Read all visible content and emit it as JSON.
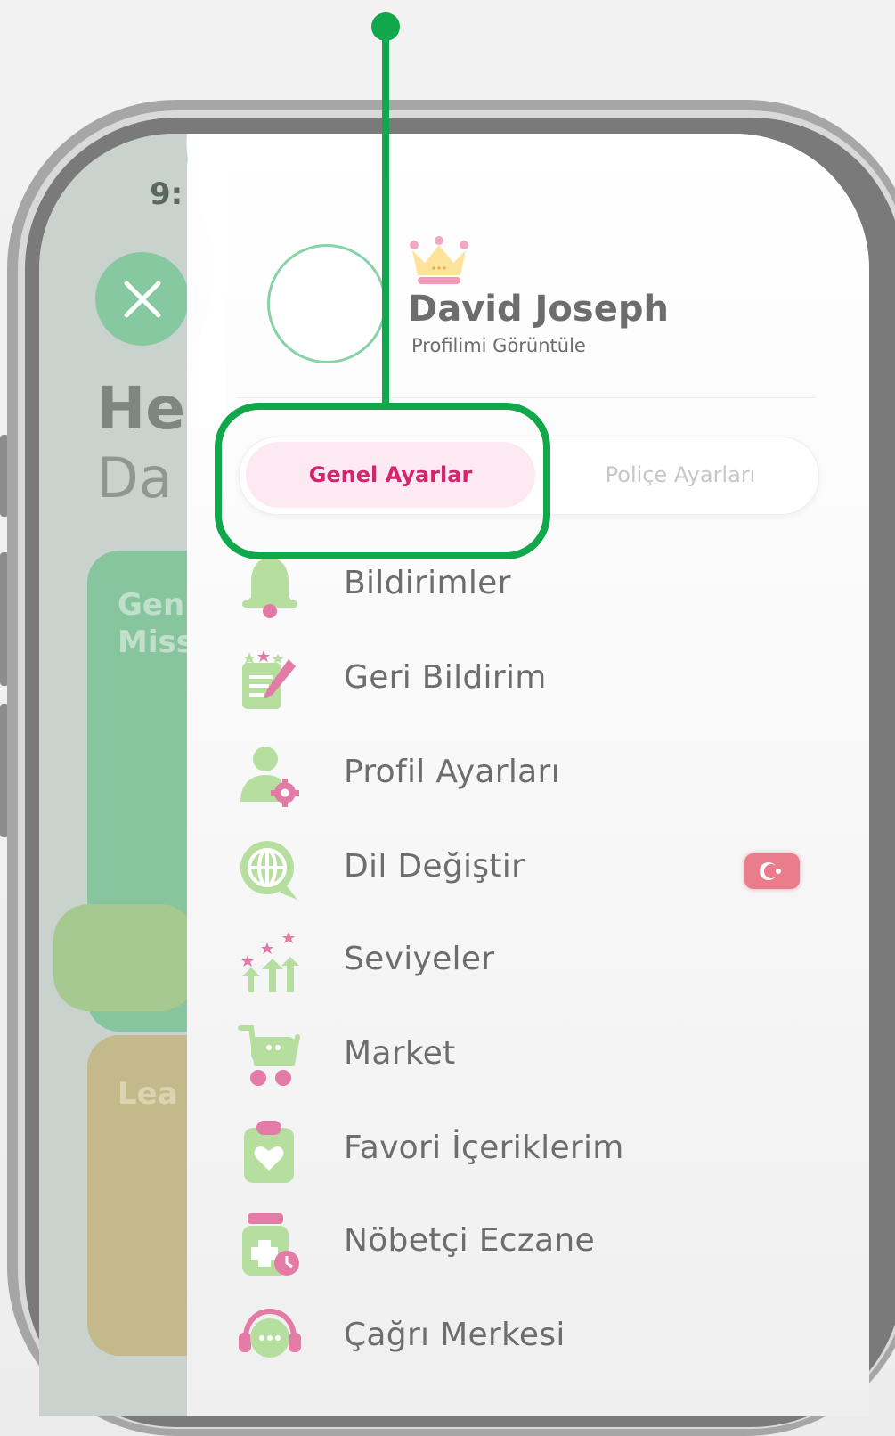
{
  "app_background": {
    "time_fragment": "9:",
    "greeting_line1": "He",
    "greeting_line2": "Da",
    "card_green_text_line1": "Gen",
    "card_green_text_line2": "Miss",
    "card_yellow_text": "Lea"
  },
  "drawer": {
    "user": {
      "name": "David Joseph",
      "profile_link": "Profilimi Görüntüle"
    },
    "tabs": {
      "general": "Genel Ayarlar",
      "policy": "Poliçe Ayarları",
      "active": "general"
    },
    "menu": [
      {
        "label": "Bildirimler",
        "icon": "bell-icon"
      },
      {
        "label": "Geri Bildirim",
        "icon": "feedback-icon"
      },
      {
        "label": "Profil Ayarları",
        "icon": "user-settings-icon"
      },
      {
        "label": "Dil Değiştir",
        "icon": "globe-icon",
        "flag": "turkey-flag"
      },
      {
        "label": "Seviyeler",
        "icon": "levels-icon"
      },
      {
        "label": "Market",
        "icon": "cart-icon"
      },
      {
        "label": "Favori İçeriklerim",
        "icon": "favorite-clipboard-icon"
      },
      {
        "label": "Nöbetçi Eczane",
        "icon": "pharmacy-icon"
      },
      {
        "label": "Çağrı Merkesi",
        "icon": "call-center-icon"
      }
    ]
  },
  "colors": {
    "accent_pink": "#d2256d",
    "icon_green": "#a7d98c",
    "icon_pink": "#e47aa6",
    "highlight_green": "#10a84a"
  }
}
